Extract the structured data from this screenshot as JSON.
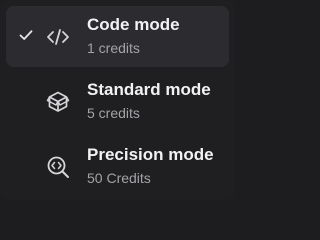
{
  "menu": {
    "items": [
      {
        "label": "Code mode",
        "credits": "1 credits",
        "icon": "code-brackets-icon",
        "selected": true
      },
      {
        "label": "Standard mode",
        "credits": "5 credits",
        "icon": "cube-box-icon",
        "selected": false
      },
      {
        "label": "Precision mode",
        "credits": "50 Credits",
        "icon": "precision-search-icon",
        "selected": false
      }
    ]
  },
  "colors": {
    "background": "#1f1f21",
    "selected_background": "#2c2c30",
    "title_text": "#f2f2f4",
    "subtitle_text": "#a3a3a8",
    "icon": "#d6d6da"
  }
}
